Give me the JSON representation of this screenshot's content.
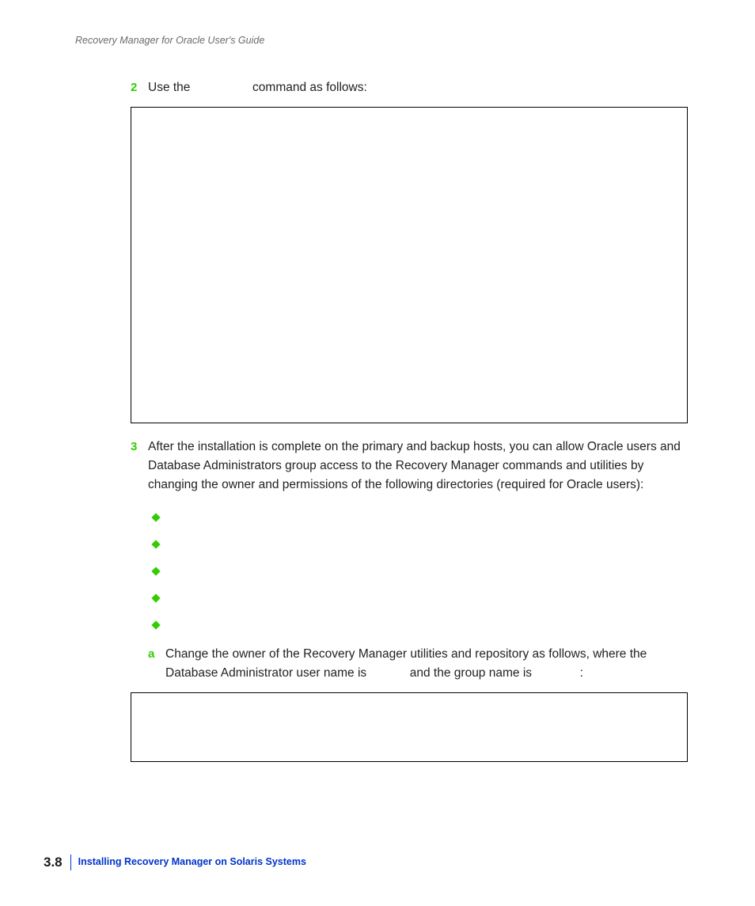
{
  "header": {
    "running_title": "Recovery Manager for Oracle User's Guide"
  },
  "steps": {
    "s2": {
      "num": "2",
      "text_a": "Use the ",
      "text_b": " command as follows:"
    },
    "s3": {
      "num": "3",
      "text": "After the installation is complete on the primary and backup hosts, you can allow Oracle users and Database Administrators group access to the Recovery Manager commands and utilities by changing the owner and permissions of the following directories (required for Oracle users):"
    },
    "bullets": [
      "",
      "",
      "",
      "",
      ""
    ],
    "sa": {
      "num": "a",
      "text_a": "Change the owner of the Recovery Manager utilities and repository as follows, where the Database Administrator user name is ",
      "text_b": " and the group name is ",
      "text_c": ":"
    }
  },
  "footer": {
    "page_number": "3.8",
    "section_title": "Installing Recovery Manager on Solaris Systems"
  }
}
